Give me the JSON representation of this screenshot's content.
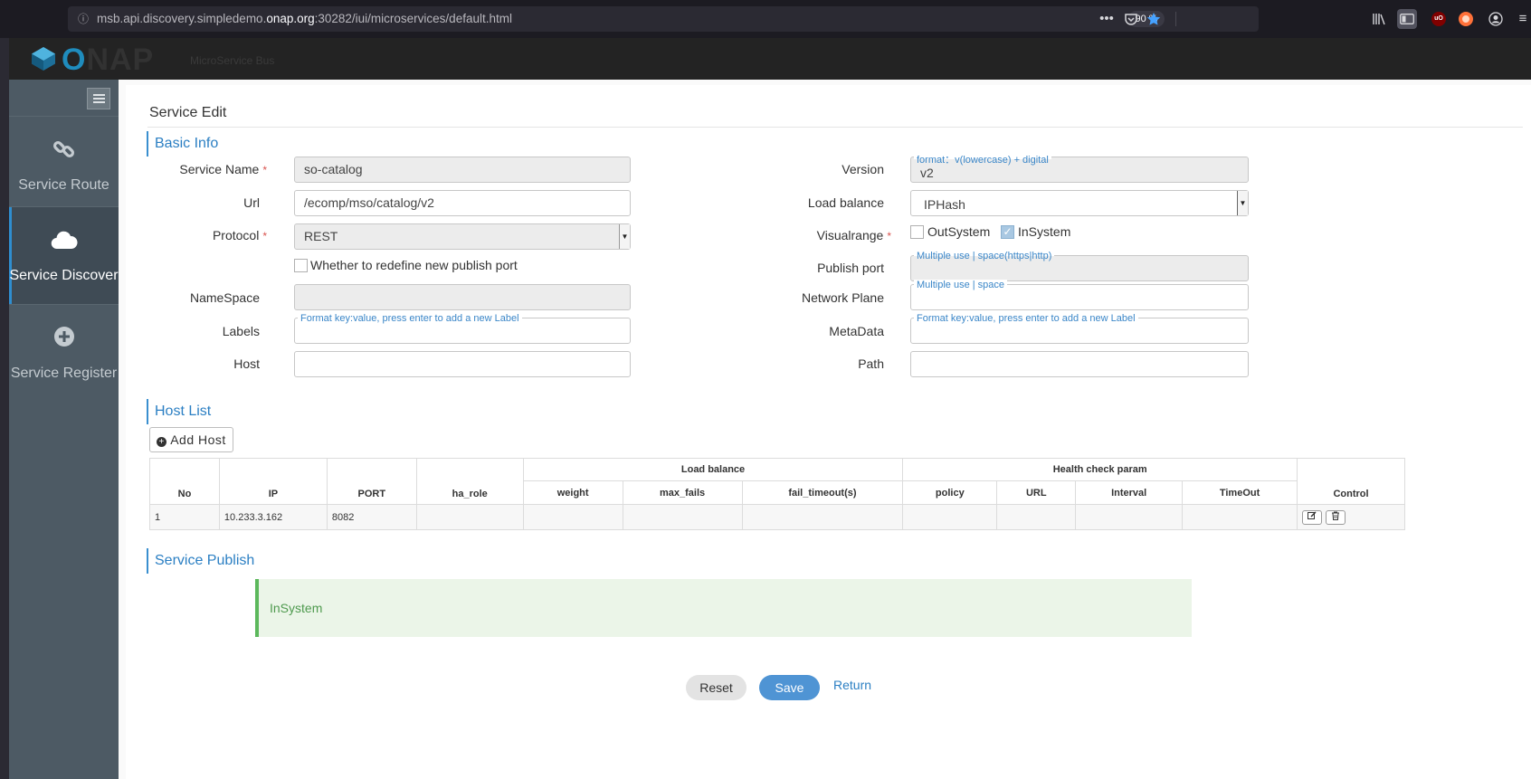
{
  "browser": {
    "url_prefix": "msb.api.discovery.simpledemo.",
    "url_domain": "onap.org",
    "url_suffix": ":30282/iui/microservices/default.html",
    "zoom": "90 %"
  },
  "header": {
    "logo_o": "O",
    "logo_nap": "NAP",
    "subtitle": "MicroService Bus"
  },
  "sidebar": {
    "items": [
      {
        "label": "Service Route",
        "icon": "link-icon",
        "active": false
      },
      {
        "label": "Service Discover",
        "icon": "cloud-icon",
        "active": true
      },
      {
        "label": "Service Register",
        "icon": "plus-circle-icon",
        "active": false
      }
    ]
  },
  "page": {
    "title": "Service Edit"
  },
  "basic_info": {
    "section_title": "Basic Info",
    "service_name": {
      "label": "Service Name",
      "value": "so-catalog",
      "required": true
    },
    "url": {
      "label": "Url",
      "value": "/ecomp/mso/catalog/v2"
    },
    "protocol": {
      "label": "Protocol",
      "value": "REST",
      "required": true
    },
    "redefine_port": {
      "label": "Whether to redefine new publish port",
      "checked": false
    },
    "namespace": {
      "label": "NameSpace",
      "value": ""
    },
    "labels": {
      "label": "Labels",
      "hint": "Format key:value, press enter to add a new Label",
      "value": ""
    },
    "host": {
      "label": "Host",
      "value": ""
    },
    "version": {
      "label": "Version",
      "hint": "format：v(lowercase) + digital",
      "value": "v2"
    },
    "load_balance": {
      "label": "Load balance",
      "value": "IPHash"
    },
    "visualrange": {
      "label": "Visualrange",
      "required": true,
      "options": [
        {
          "label": "OutSystem",
          "checked": false
        },
        {
          "label": "InSystem",
          "checked": true
        }
      ]
    },
    "publish_port": {
      "label": "Publish port",
      "hint": "Multiple use | space(https|http)",
      "value": ""
    },
    "network_plane": {
      "label": "Network Plane",
      "hint": "Multiple use | space",
      "value": ""
    },
    "metadata": {
      "label": "MetaData",
      "hint": "Format key:value, press enter to add a new Label",
      "value": ""
    },
    "path": {
      "label": "Path",
      "value": ""
    }
  },
  "host_list": {
    "section_title": "Host List",
    "add_button": "Add Host",
    "group_headers": {
      "load_balance": "Load balance",
      "health_check": "Health check param"
    },
    "columns": {
      "no": "No",
      "ip": "IP",
      "port": "PORT",
      "ha_role": "ha_role",
      "weight": "weight",
      "max_fails": "max_fails",
      "fail_timeout": "fail_timeout(s)",
      "policy": "policy",
      "url": "URL",
      "interval": "Interval",
      "timeout": "TimeOut",
      "control": "Control"
    },
    "rows": [
      {
        "no": "1",
        "ip": "10.233.3.162",
        "port": "8082",
        "ha_role": "",
        "weight": "",
        "max_fails": "",
        "fail_timeout": "",
        "policy": "",
        "url": "",
        "interval": "",
        "timeout": ""
      }
    ]
  },
  "service_publish": {
    "section_title": "Service Publish",
    "value": "InSystem"
  },
  "actions": {
    "reset": "Reset",
    "save": "Save",
    "return": "Return"
  }
}
